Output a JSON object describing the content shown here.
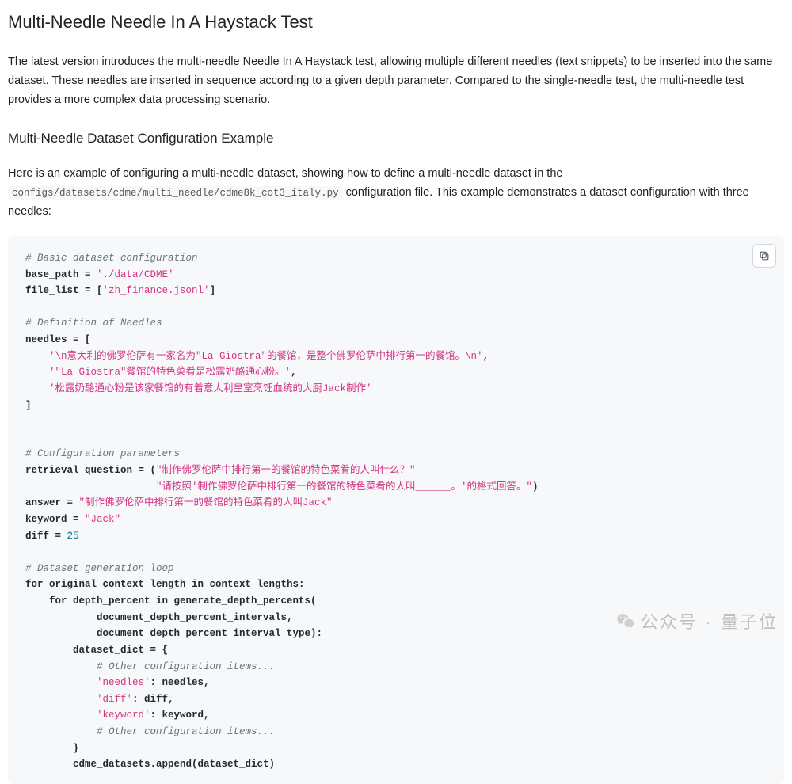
{
  "title": "Multi-Needle Needle In A Haystack Test",
  "intro": "The latest version introduces the multi-needle Needle In A Haystack test, allowing multiple different needles (text snippets) to be inserted into the same dataset. These needles are inserted in sequence according to a given depth parameter. Compared to the single-needle test, the multi-needle test provides a more complex data processing scenario.",
  "section2_title": "Multi-Needle Dataset Configuration Example",
  "section2_intro_a": "Here is an example of configuring a multi-needle dataset, showing how to define a multi-needle dataset in the ",
  "config_path": "configs/datasets/cdme/multi_needle/cdme8k_cot3_italy.py",
  "section2_intro_b": " configuration file. This example demonstrates a dataset configuration with three needles:",
  "code": {
    "c1": "# Basic dataset configuration",
    "l1a": "base_path = ",
    "l1b": "'./data/CDME'",
    "l2a": "file_list = [",
    "l2b": "'zh_finance.jsonl'",
    "l2c": "]",
    "c2": "# Definition of Needles",
    "l3": "needles = [",
    "n1": "'\\n意大利的佛罗伦萨有一家名为\"La Giostra\"的餐馆，是整个佛罗伦萨中排行第一的餐馆。\\n'",
    "n2": "'\"La Giostra\"餐馆的特色菜肴是松露奶酪通心粉。'",
    "n3": "'松露奶酪通心粉是该家餐馆的有着意大利皇室烹饪血统的大厨Jack制作'",
    "l4": "]",
    "c3": "# Configuration parameters",
    "rq1a": "retrieval_question = (",
    "rq1b": "\"制作佛罗伦萨中排行第一的餐馆的特色菜肴的人叫什么？\"",
    "rq2a": "\"请按照'制作佛罗伦萨中排行第一的餐馆的特色菜肴的人叫______。'的格式回答。\"",
    "rq2b": ")",
    "ans_a": "answer = ",
    "ans_b": "\"制作佛罗伦萨中排行第一的餐馆的特色菜肴的人叫Jack\"",
    "kw_a": "keyword = ",
    "kw_b": "\"Jack\"",
    "diff_a": "diff = ",
    "diff_b": "25",
    "c4": "# Dataset generation loop",
    "loop1": "for original_context_length in context_lengths:",
    "loop2": "    for depth_percent in generate_depth_percents(",
    "loop3": "            document_depth_percent_intervals,",
    "loop4": "            document_depth_percent_interval_type):",
    "loop5": "        dataset_dict = {",
    "c5": "            # Other configuration items...",
    "d1a": "            ",
    "d1k": "'needles'",
    "d1b": ": needles,",
    "d2k": "'diff'",
    "d2b": ": diff,",
    "d3k": "'keyword'",
    "d3b": ": keyword,",
    "c6": "            # Other configuration items...",
    "loop6": "        }",
    "loop7": "        cdme_datasets.append(dataset_dict)"
  },
  "watermark": {
    "label": "公众号",
    "name": "量子位"
  }
}
